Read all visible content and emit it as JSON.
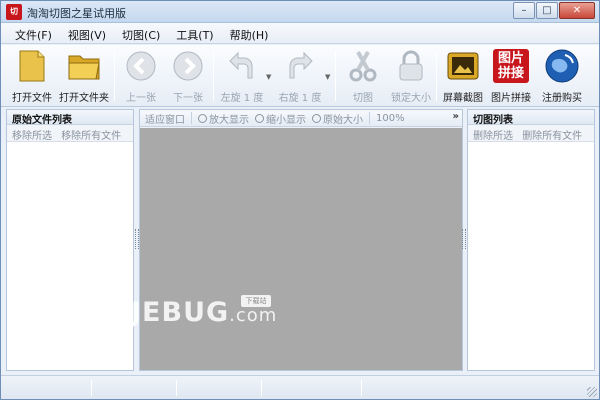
{
  "window": {
    "title": "淘淘切图之星试用版",
    "icon_text": "切",
    "controls": {
      "minimize": "–",
      "maximize": "□",
      "close": "✕"
    }
  },
  "menu": [
    {
      "label": "文件(F)"
    },
    {
      "label": "视图(V)"
    },
    {
      "label": "切图(C)"
    },
    {
      "label": "工具(T)"
    },
    {
      "label": "帮助(H)"
    }
  ],
  "toolbar": {
    "open_file": "打开文件",
    "open_folder": "打开文件夹",
    "prev": "上一张",
    "next": "下一张",
    "rotate_left": "左旋 1 度",
    "rotate_right": "右旋 1 度",
    "cut": "切图",
    "lock_size": "锁定大小",
    "screenshot": "屏幕截图",
    "stitch": "图片拼接",
    "stitch_icon_text": "图片拼接",
    "register": "注册购买"
  },
  "left_panel": {
    "title": "原始文件列表",
    "remove_selected": "移除所选",
    "remove_all": "移除所有文件"
  },
  "right_panel": {
    "title": "切图列表",
    "remove_selected": "删除所选",
    "remove_all": "删除所有文件"
  },
  "viewbar": {
    "fit": "适应窗口",
    "zoom_in": "放大显示",
    "zoom_out": "缩小显示",
    "original": "原始大小",
    "zoom_level": "100%",
    "more": "»"
  },
  "watermark": {
    "brand": "JEBUG",
    "domain": ".com",
    "tag": "下载站"
  },
  "colors": {
    "canvas": "#a9a9a9",
    "accent": "#c8161d"
  }
}
